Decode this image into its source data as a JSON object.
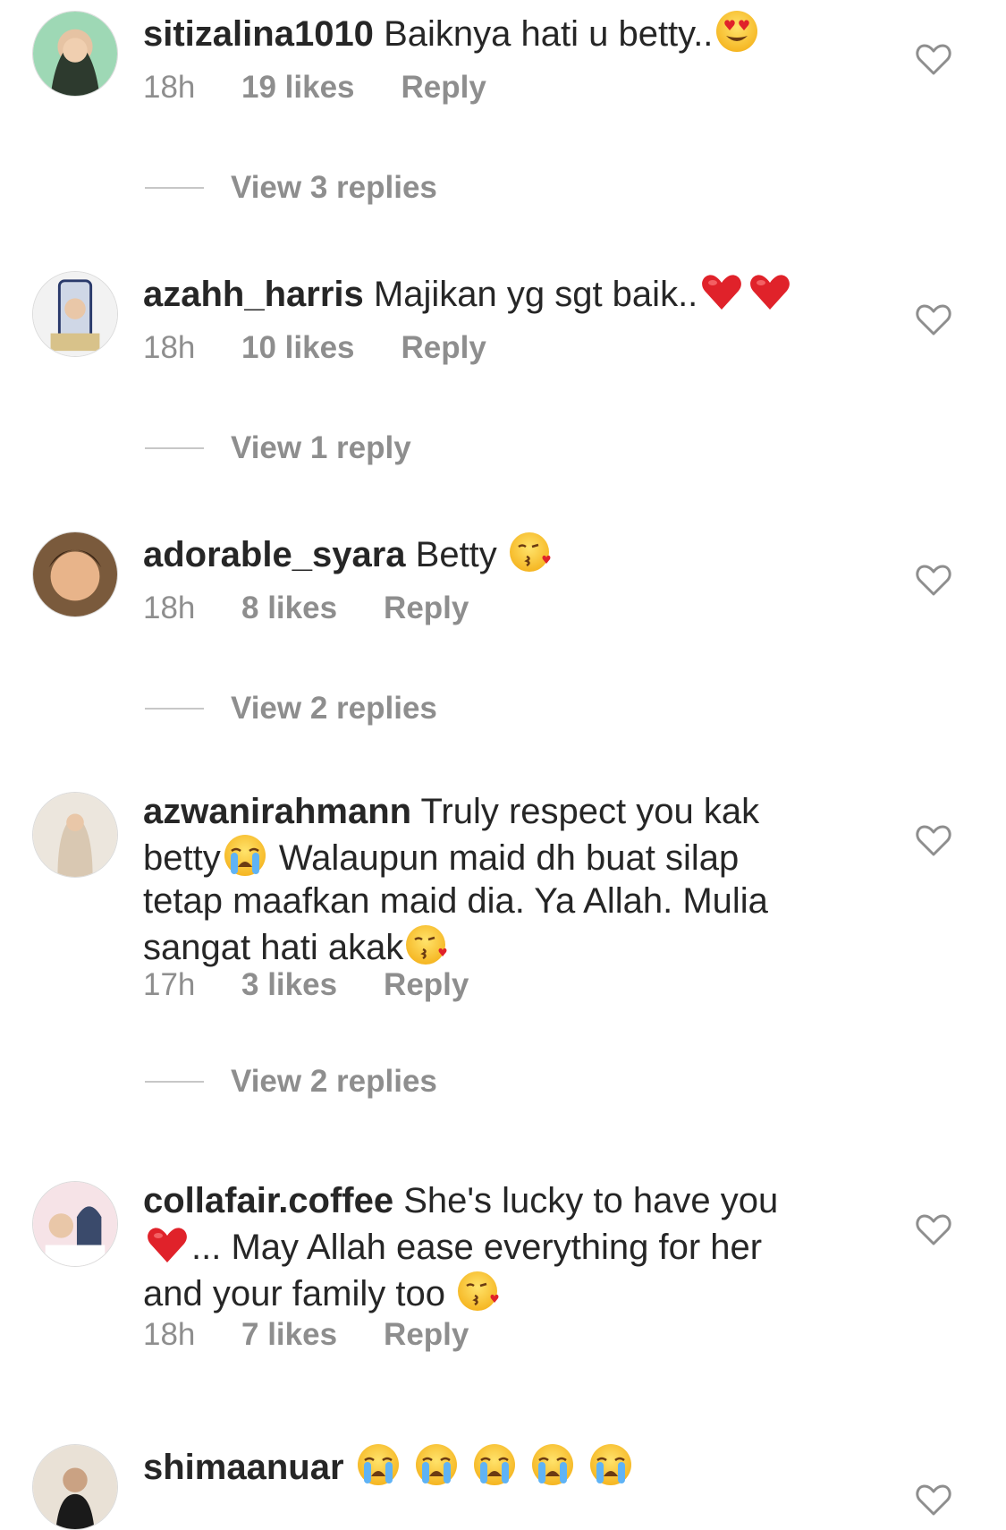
{
  "comments": [
    {
      "username": "sitizalina1010",
      "text": "Baiknya hati u betty..",
      "emojis": [
        "heart-eyes-emoji"
      ],
      "time": "18h",
      "likes": "19 likes",
      "reply": "Reply",
      "view_replies": "View 3 replies"
    },
    {
      "username": "azahh_harris",
      "text": "Majikan yg sgt baik..",
      "emojis": [
        "red-heart-emoji",
        "red-heart-emoji"
      ],
      "time": "18h",
      "likes": "10 likes",
      "reply": "Reply",
      "view_replies": "View 1 reply"
    },
    {
      "username": "adorable_syara",
      "text": "Betty",
      "emojis": [
        "kissing-heart-emoji"
      ],
      "time": "18h",
      "likes": "8 likes",
      "reply": "Reply",
      "view_replies": "View 2 replies"
    },
    {
      "username": "azwanirahmann",
      "text_line1": "Truly respect you kak",
      "text_line2a": "betty",
      "text_line2b": "Walaupun maid dh buat silap",
      "text_line3": "tetap maafkan maid dia. Ya Allah. Mulia",
      "text_line4": "sangat hati akak",
      "emojis": [
        "crying-emoji",
        "kissing-heart-emoji"
      ],
      "time": "17h",
      "likes": "3 likes",
      "reply": "Reply",
      "view_replies": "View 2 replies"
    },
    {
      "username": "collafair.coffee",
      "text_line1": "She's lucky to have you",
      "text_line2": "... May Allah ease everything for her",
      "text_line3": "and your family too",
      "emojis": [
        "red-heart-emoji",
        "kissing-heart-emoji"
      ],
      "time": "18h",
      "likes": "7 likes",
      "reply": "Reply"
    },
    {
      "username": "shimaanuar",
      "emojis": [
        "crying-emoji",
        "crying-emoji",
        "crying-emoji",
        "crying-emoji",
        "crying-emoji"
      ]
    }
  ],
  "icons": {
    "like": "heart-outline-icon"
  },
  "colors": {
    "text": "#262626",
    "secondary": "#8e8e8e",
    "divider": "#c7c7c7",
    "emoji_heart": "#e0222a"
  }
}
